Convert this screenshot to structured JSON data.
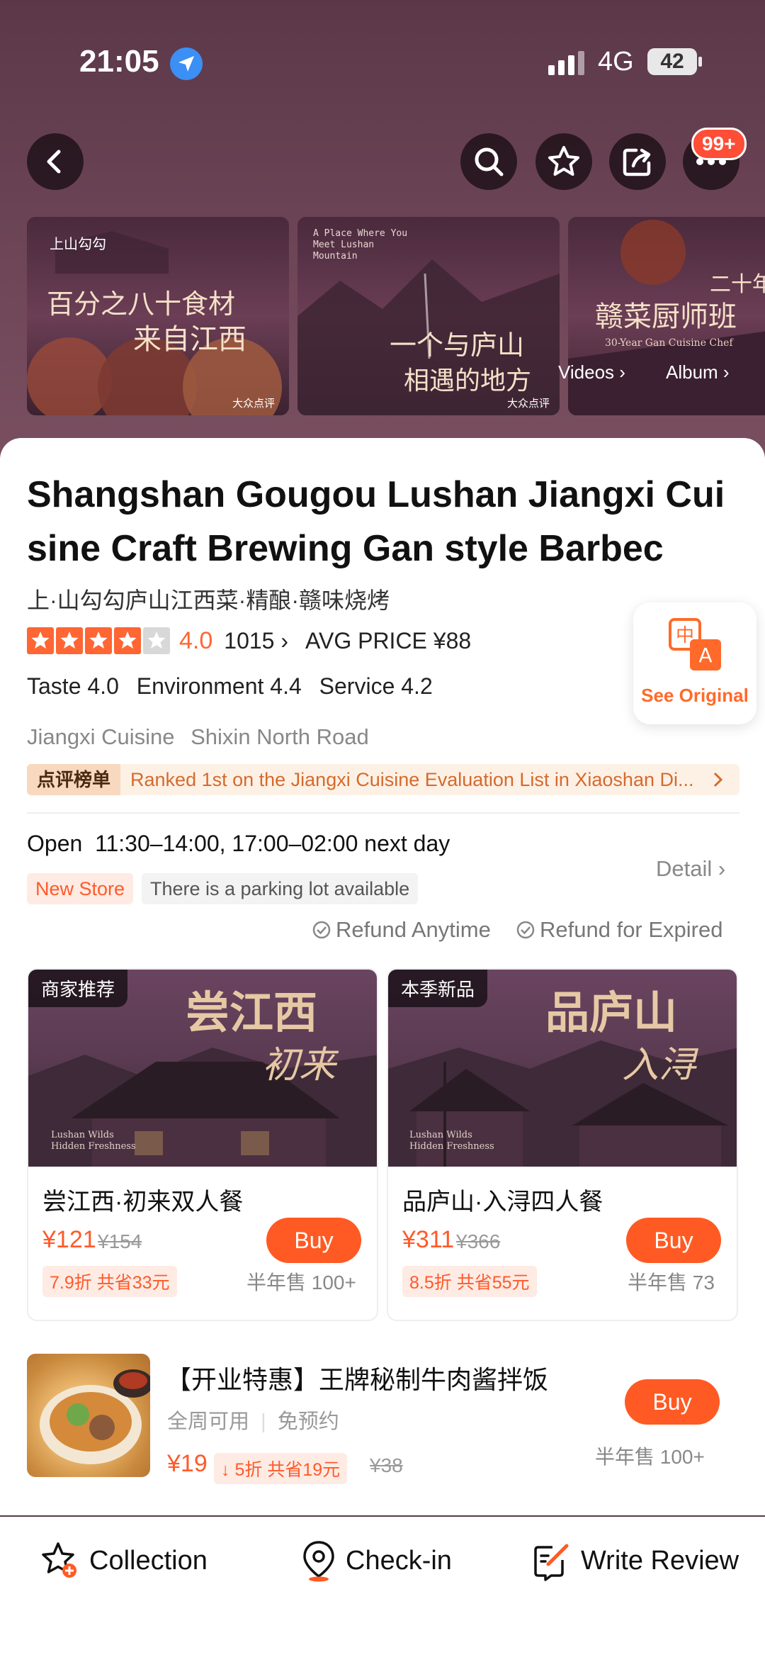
{
  "status_bar": {
    "time": "21:05",
    "network": "4G",
    "battery": "42"
  },
  "header": {
    "badge": "99+"
  },
  "media": {
    "thumb1": {
      "brand": "上山勾勾",
      "line1": "百分之八十食材",
      "line2": "来自江西",
      "watermark": "大众点评"
    },
    "thumb2": {
      "en": "A Place Where You Meet Lushan Mountain",
      "line1": "一个与庐山",
      "line2": "相遇的地方",
      "watermark": "大众点评"
    },
    "thumb3": {
      "line1": "赣菜厨师班",
      "en": "30-Year Gan Cuisine Chef",
      "corner": "二十年"
    },
    "videos_label": "Videos",
    "album_label": "Album"
  },
  "shop": {
    "title": "Shangshan Gougou Lushan Jiangxi Cuisine Craft Brewing Gan style Barbec",
    "subtitle": "上·山勾勾庐山江西菜·精酿·赣味烧烤",
    "rating": "4.0",
    "stars": 4,
    "review_count": "1015",
    "avg_price": "AVG PRICE ¥88",
    "taste": "Taste 4.0",
    "environment": "Environment 4.4",
    "service": "Service 4.2",
    "category": "Jiangxi Cuisine",
    "area": "Shixin North Road",
    "rank_tag": "点评榜单",
    "rank_text": "Ranked 1st on the Jiangxi Cuisine Evaluation List in Xiaoshan Di...",
    "see_original": "See Original",
    "open_label": "Open",
    "hours": "11:30–14:00, 17:00–02:00 next day",
    "tag_new": "New Store",
    "tag_parking": "There is a parking lot available",
    "detail": "Detail",
    "refund1": "Refund Anytime",
    "refund2": "Refund for Expired"
  },
  "deals": [
    {
      "badge": "商家推荐",
      "cap1": "尝江西",
      "cap2": "初来",
      "caption_en": "Lushan Wilds Hidden Freshness",
      "name": "尝江西·初来双人餐",
      "price": "¥121",
      "original": "¥154",
      "discount": "7.9折 共省33元",
      "sold": "半年售 100+",
      "buy": "Buy"
    },
    {
      "badge": "本季新品",
      "cap1": "品庐山",
      "cap2": "入浔",
      "caption_en": "Lushan Wilds Hidden Freshness",
      "name": "品庐山·入浔四人餐",
      "price": "¥311",
      "original": "¥366",
      "discount": "8.5折 共省55元",
      "sold": "半年售 73",
      "buy": "Buy"
    }
  ],
  "combo": {
    "title": "【开业特惠】王牌秘制牛肉酱拌饭",
    "sub1": "全周可用",
    "sub2": "免预约",
    "price": "¥19",
    "discount": "5折 共省19元",
    "original": "¥38",
    "sold": "半年售 100+",
    "buy": "Buy"
  },
  "bottom_bar": {
    "collection": "Collection",
    "checkin": "Check-in",
    "review": "Write Review"
  },
  "colors": {
    "accent": "#ff5a23",
    "star": "#ff6633",
    "hero": "#5b3848"
  }
}
